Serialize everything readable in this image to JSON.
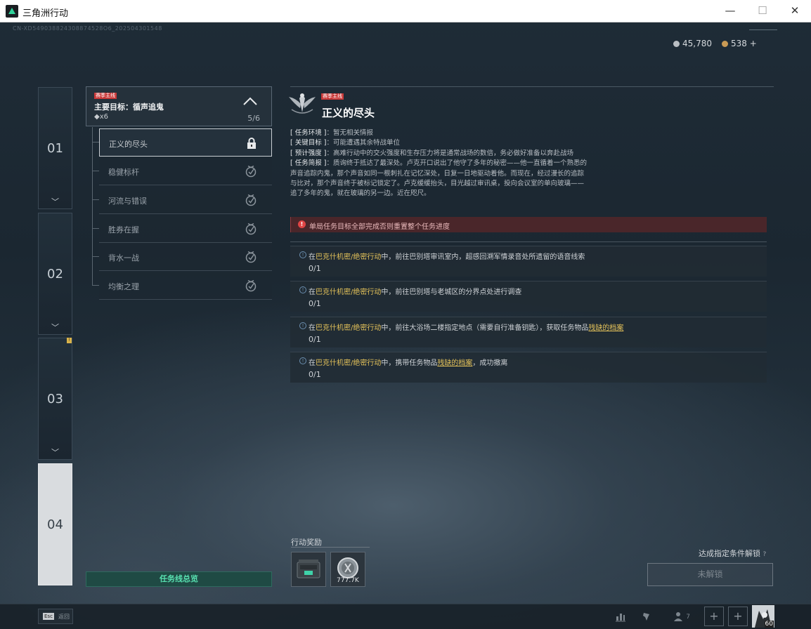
{
  "window": {
    "title": "三角洲行动",
    "minimize": "—",
    "maximize": "☐",
    "close": "✕"
  },
  "serial": "CN-XD549038824308874528O6_202504301548",
  "currency": {
    "silver": "45,780",
    "gold": "538",
    "add": "+"
  },
  "chapters": [
    {
      "num": "01",
      "chevron": "﹀"
    },
    {
      "num": "02",
      "chevron": "﹀"
    },
    {
      "num": "03",
      "chevron": "﹀",
      "badge": "!"
    },
    {
      "num": "04",
      "chevron": ""
    }
  ],
  "mission_line": {
    "tag": "赛季主线",
    "goal": "主要目标：循声追鬼",
    "reward": "◆x6",
    "progress": "5/6"
  },
  "missions": [
    {
      "label": "正义的尽头",
      "state": "locked"
    },
    {
      "label": "稳健标杆",
      "state": "done"
    },
    {
      "label": "河流与错误",
      "state": "done"
    },
    {
      "label": "胜券在握",
      "state": "done"
    },
    {
      "label": "背水一战",
      "state": "done"
    },
    {
      "label": "均衡之理",
      "state": "done"
    }
  ],
  "overview_button": "任务线总览",
  "detail": {
    "tag": "赛季主线",
    "title": "正义的尽头",
    "env_label": "[ 任务环境 ]",
    "env_text": "：暂无相关情报",
    "target_label": "[ 关键目标 ]",
    "target_text": "：可能遭遇其余特战单位",
    "intensity_label": "[ 预计强度 ]",
    "intensity_text": "：高难行动中的交火强度和生存压力将是通常战场的数倍，务必做好准备以奔赴战场",
    "brief_label": "[ 任务简报 ]",
    "brief_text": "：质询终于抵达了最深处。卢克开口说出了他守了多年的秘密——他一直循着一个熟悉的声音追踪内鬼，那个声音如同一根刺扎在记忆深处，日复一日地驱动着他。而现在，经过漫长的追踪与比对，那个声音终于被标记锁定了。卢克缓缓抬头，目光越过审讯桌，投向会议室的单向玻璃——追了多年的鬼，就在玻璃的另一边。近在咫尺。",
    "warning_icon": "!",
    "warning": "单局任务目标全部完成否则重置整个任务进度"
  },
  "objectives": [
    {
      "pre": "在",
      "mode": "巴克什机密/绝密行动",
      "mid": "中，前往巴别塔审讯室内，超感回溯军情录音处所遗留的语音线索",
      "item": "",
      "post": "",
      "progress": "0/1"
    },
    {
      "pre": "在",
      "mode": "巴克什机密/绝密行动",
      "mid": "中，前往巴别塔与老城区的分界点处进行调查",
      "item": "",
      "post": "",
      "progress": "0/1"
    },
    {
      "pre": "在",
      "mode": "巴克什机密/绝密行动",
      "mid": "中，前往大浴场二楼指定地点（需要自行准备钥匙），获取任务物品",
      "item": "残缺的档案",
      "post": "",
      "progress": "0/1"
    },
    {
      "pre": "在",
      "mode": "巴克什机密/绝密行动",
      "mid": "中，携带任务物品",
      "item": "残缺的档案",
      "post": "，成功撤离",
      "progress": "0/1"
    }
  ],
  "objective_icon": "!",
  "rewards": {
    "label": "行动奖励",
    "coin_amount": "777.7K"
  },
  "unlock": {
    "condition": "达成指定条件解锁",
    "help": "?",
    "button": "未解锁"
  },
  "bottom": {
    "esc_key": "Esc",
    "esc_label": "返回",
    "friends": "7",
    "add1": "+",
    "add2": "+",
    "level": "60"
  },
  "colors": {
    "accent_green": "#58e0b0",
    "tag_red": "#c83737",
    "item_gold": "#e4c25a"
  }
}
